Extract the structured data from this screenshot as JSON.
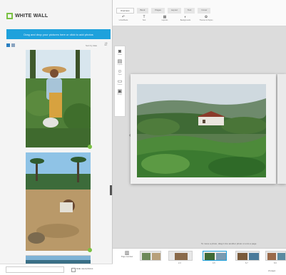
{
  "app": {
    "brand": "WHITE WALL",
    "accent": "#1ea1dc",
    "brand_green": "#7ac143"
  },
  "sidebar": {
    "upload_label": "Drag and drop your pictures here or click to add photos",
    "sort_label": "Sort by date",
    "thumbnails": [
      {
        "subject": "tea-picker-woman"
      },
      {
        "subject": "beach-boy"
      },
      {
        "subject": "coastline"
      }
    ],
    "bottom": {
      "checkbox_label": "Hide used photos"
    }
  },
  "toolbar": {
    "tabs": [
      "Overview",
      "Book",
      "Pages",
      "Layout",
      "Text",
      "Cover"
    ],
    "active_tab": 0,
    "tools": [
      {
        "icon": "undo-icon",
        "label": "Undo/Redo"
      },
      {
        "icon": "text-icon",
        "label": "Text"
      },
      {
        "icon": "layout-icon",
        "label": "Layouts"
      },
      {
        "icon": "background-icon",
        "label": "Backgrounds"
      },
      {
        "icon": "theme-icon",
        "label": "Themes & Styles"
      }
    ]
  },
  "left_tools": [
    "Photos",
    "Layouts",
    "Clipart",
    "Frames",
    "Backgr."
  ],
  "canvas": {
    "hint": "To move a photo, drag it into another photo or onto a page"
  },
  "filmstrip": {
    "overview_label": "Page overview",
    "pages": [
      "",
      "2-3",
      "4-5",
      "6-7",
      "8-9",
      "10-11"
    ],
    "active_page": 3,
    "status": "24 pages"
  }
}
